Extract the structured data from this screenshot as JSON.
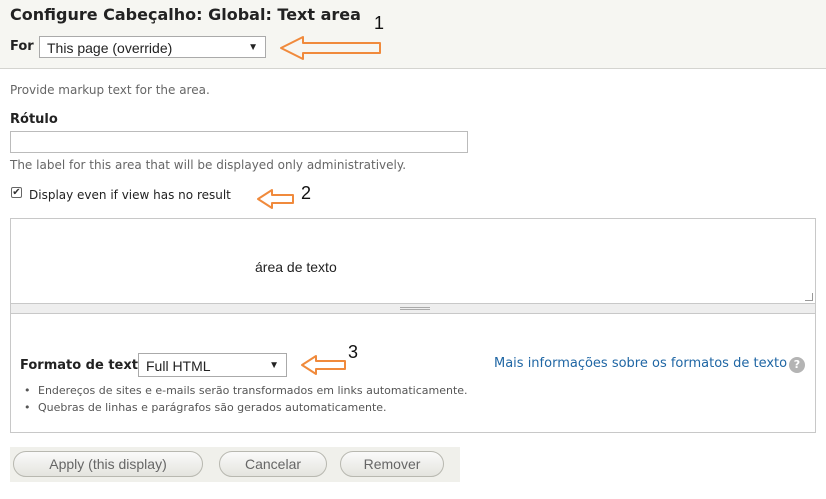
{
  "dialog": {
    "title": "Configure Cabeçalho: Global: Text area",
    "for_label": "For",
    "for_value": "This page (override)"
  },
  "form": {
    "description": "Provide markup text for the area.",
    "label_title": "Rótulo",
    "label_value": "",
    "label_help": "The label for this area that will be displayed only administratively.",
    "empty_checkbox_label": "Display even if view has no result",
    "empty_checked": true,
    "textarea_content": "área de texto"
  },
  "format": {
    "label": "Formato de texto",
    "value": "Full HTML",
    "more_link": "Mais informações sobre os formatos de texto",
    "help_icon": "?",
    "tips": [
      "Endereços de sites e e-mails serão transformados em links automaticamente.",
      "Quebras de linhas e parágrafos são gerados automaticamente."
    ]
  },
  "buttons": {
    "apply": "Apply (this display)",
    "cancel": "Cancelar",
    "remove": "Remover"
  },
  "annotations": {
    "one": "1",
    "two": "2",
    "three": "3",
    "arrow_color": "#f08a3c"
  },
  "icons": {
    "caret": "▼",
    "check": "✔"
  }
}
